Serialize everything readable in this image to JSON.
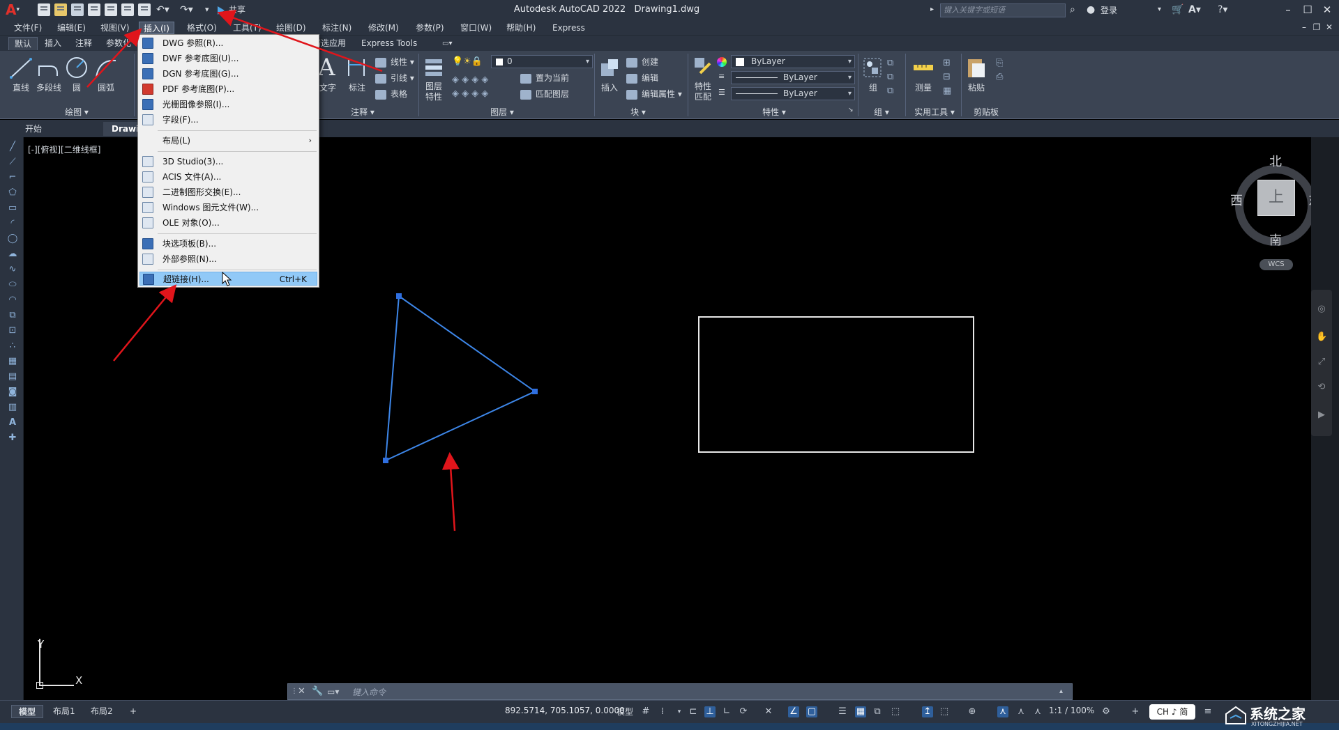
{
  "app": {
    "title": "Autodesk AutoCAD 2022",
    "drawing": "Drawing1.dwg",
    "share_label": "共享",
    "search_placeholder": "键入关键字或短语",
    "login_label": "登录"
  },
  "menubar": {
    "items": [
      "文件(F)",
      "编辑(E)",
      "视图(V)",
      "插入(I)",
      "格式(O)",
      "工具(T)",
      "绘图(D)",
      "标注(N)",
      "修改(M)",
      "参数(P)",
      "窗口(W)",
      "帮助(H)",
      "Express"
    ]
  },
  "ribbon_tabs": [
    "默认",
    "插入",
    "注释",
    "参数化",
    "精选应用",
    "Express Tools"
  ],
  "ribbon": {
    "draw": {
      "title": "绘图",
      "tools": [
        "直线",
        "多段线",
        "圆",
        "圆弧"
      ]
    },
    "annotation": {
      "title": "注释",
      "text": "文字",
      "dim": "标注",
      "rows": [
        "线性",
        "引线",
        "表格"
      ]
    },
    "layers": {
      "title": "图层",
      "props_label_1": "图层",
      "props_label_2": "特性",
      "layer_value": "0",
      "rows": [
        "置为当前",
        "匹配图层"
      ]
    },
    "block": {
      "title": "块",
      "insert": "插入",
      "rows": [
        "创建",
        "编辑",
        "编辑属性"
      ]
    },
    "properties": {
      "title": "特性",
      "match_1": "特性",
      "match_2": "匹配",
      "color": "ByLayer",
      "linetype": "ByLayer",
      "lineweight": "ByLayer"
    },
    "groups": {
      "title": "组",
      "group": "组"
    },
    "utilities": {
      "title": "实用工具",
      "measure": "测量"
    },
    "clipboard": {
      "title": "剪贴板",
      "paste": "粘贴"
    }
  },
  "file_tabs": [
    "开始",
    "Drawi"
  ],
  "viewport_label": "[-][俯视][二维线框]",
  "viewcube": {
    "north": "北",
    "south": "南",
    "east": "东",
    "west": "西",
    "face": "上",
    "wcs": "WCS"
  },
  "ucs": {
    "x": "X",
    "y": "Y"
  },
  "command": {
    "placeholder": "键入命令"
  },
  "layout_tabs": [
    "模型",
    "布局1",
    "布局2"
  ],
  "status": {
    "coords": "892.5714, 705.1057, 0.0000",
    "model": "模型",
    "scale": "1:1 / 100%",
    "ime": "CH ♪ 简"
  },
  "watermark": {
    "text": "系统之家",
    "sub": "XITONGZHIJIA.NET"
  },
  "dropdown": {
    "items": [
      {
        "label": "DWG 参照(R)...",
        "shortcut": ""
      },
      {
        "label": "DWF 参考底图(U)...",
        "shortcut": ""
      },
      {
        "label": "DGN 参考底图(G)...",
        "shortcut": ""
      },
      {
        "label": "PDF 参考底图(P)...",
        "shortcut": ""
      },
      {
        "label": "光栅图像参照(I)...",
        "shortcut": ""
      },
      {
        "label": "字段(F)...",
        "shortcut": ""
      },
      {
        "label": "布局(L)",
        "shortcut": ""
      },
      {
        "label": "3D Studio(3)...",
        "shortcut": ""
      },
      {
        "label": "ACIS 文件(A)...",
        "shortcut": ""
      },
      {
        "label": "二进制图形交换(E)...",
        "shortcut": ""
      },
      {
        "label": "Windows 图元文件(W)...",
        "shortcut": ""
      },
      {
        "label": "OLE 对象(O)...",
        "shortcut": ""
      },
      {
        "label": "块选项板(B)...",
        "shortcut": ""
      },
      {
        "label": "外部参照(N)...",
        "shortcut": ""
      },
      {
        "label": "超链接(H)...",
        "shortcut": "Ctrl+K"
      }
    ]
  },
  "colors": {
    "accent": "#2f5f9b",
    "menu_highlight": "#91c9f7",
    "annotation": "#e0151b",
    "selection": "#3d86e8"
  }
}
